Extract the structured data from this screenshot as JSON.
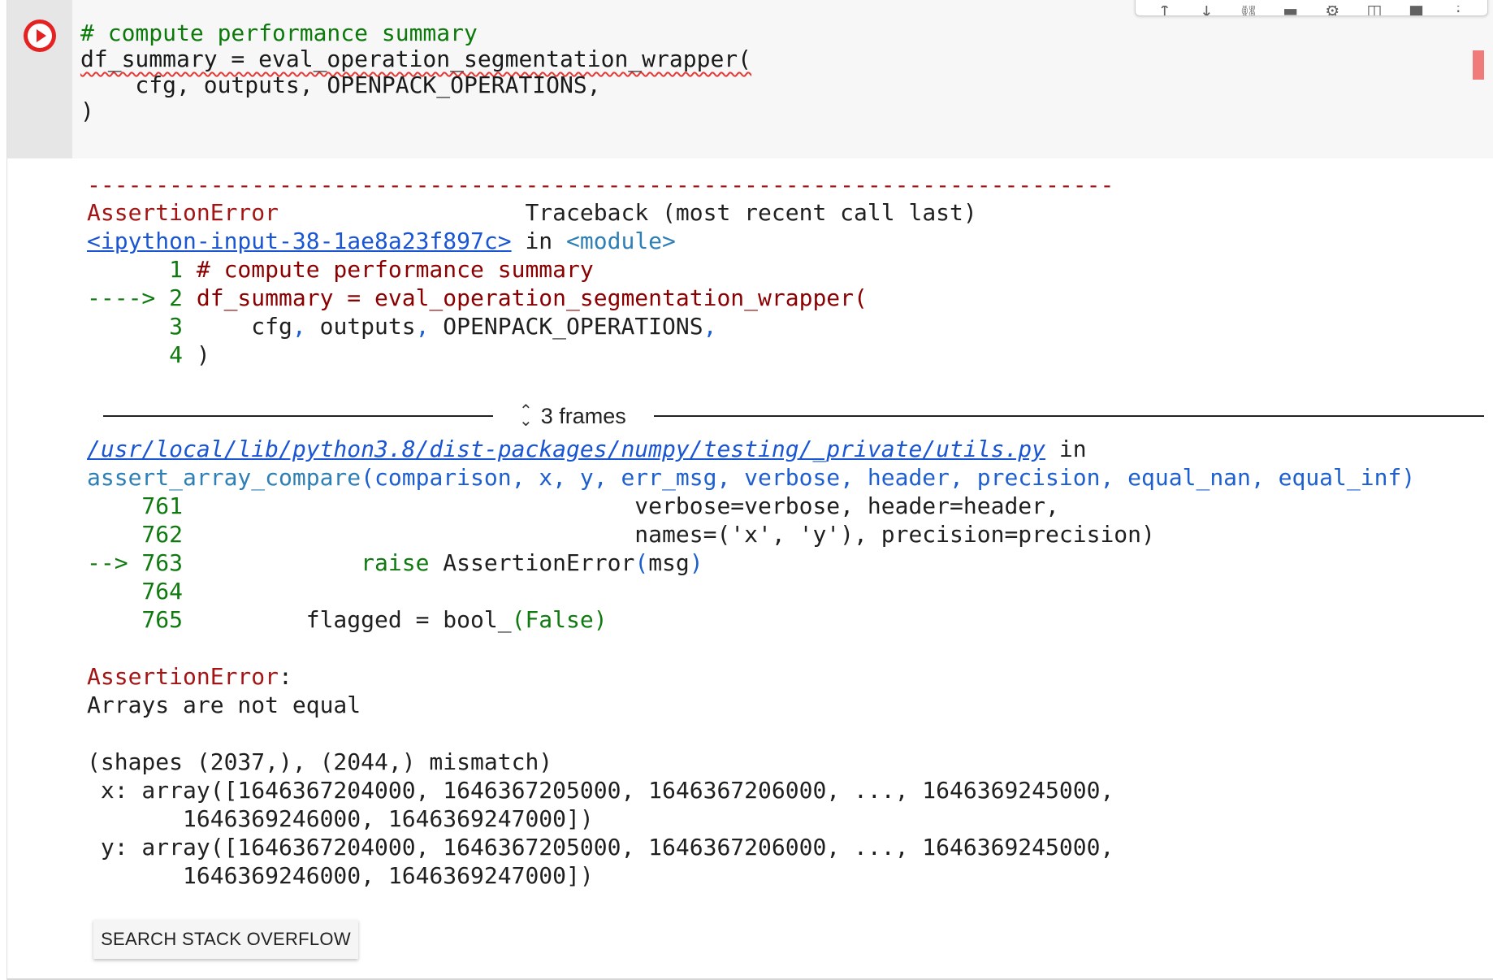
{
  "toolbar": {
    "icons": [
      "arrow-up-icon",
      "arrow-down-icon",
      "link-icon",
      "comment-icon",
      "settings-icon",
      "mirror-cell-icon",
      "delete-icon",
      "more-icon"
    ]
  },
  "input": {
    "line1": "# compute performance summary",
    "line2_var": "df_summary = eval_operation_segmentation_wrapper(",
    "line3": "    cfg, outputs, OPENPACK_OPERATIONS,",
    "line4": ")"
  },
  "output": {
    "dashes": "---------------------------------------------------------------------------",
    "err_name": "AssertionError",
    "traceback_label": "Traceback (most recent call last)",
    "frame1_link": "<ipython-input-38-1ae8a23f897c>",
    "frame1_in": " in ",
    "frame1_module": "<module>",
    "f1_l1_num": "      1 ",
    "f1_l1_code": "# compute performance summary",
    "f1_l2_arrow": "----> 2 ",
    "f1_l2_code": "df_summary = eval_operation_segmentation_wrapper(",
    "f1_l3_num": "      3 ",
    "f1_l3_code": "    cfg",
    "f1_l3_comma1": ",",
    "f1_l3_mid": " outputs",
    "f1_l3_comma2": ",",
    "f1_l3_end": " OPENPACK_OPERATIONS",
    "f1_l3_comma3": ",",
    "f1_l4_num": "      4 ",
    "f1_l4_code": ")",
    "frames_label": "3 frames",
    "frame2_link": "/usr/local/lib/python3.8/dist-packages/numpy/testing/_private/utils.py",
    "frame2_in": " in",
    "frame2_func": "assert_array_compare",
    "frame2_sig": "(comparison, x, y, err_msg, verbose, header, precision, equal_nan, equal_inf)",
    "l761_num": "    761 ",
    "l761_code": "                                verbose=verbose, header=header,",
    "l762_num": "    762 ",
    "l762_code": "                                names=('x', 'y'), precision=precision)",
    "l763_arrow": "--> 763 ",
    "l763_pad": "            ",
    "l763_kw": "raise",
    "l763_code": " AssertionError",
    "l763_paren1": "(",
    "l763_arg": "msg",
    "l763_paren2": ")",
    "l764_num": "    764 ",
    "l765_num": "    765 ",
    "l765_code": "        flagged = bool_",
    "l765_rest": "(False)",
    "final_err": "AssertionError",
    "final_colon": ":",
    "msg1": "Arrays are not equal",
    "msg2": "(shapes (2037,), (2044,) mismatch)",
    "msg3": " x: array([1646367204000, 1646367205000, 1646367206000, ..., 1646369245000,",
    "msg4": "       1646369246000, 1646369247000])",
    "msg5": " y: array([1646367204000, 1646367205000, 1646367206000, ..., 1646369245000,",
    "msg6": "       1646369246000, 1646369247000])"
  },
  "buttons": {
    "search_so": "SEARCH STACK OVERFLOW"
  },
  "colors": {
    "run_button": "#e52222",
    "error_red": "#a31515",
    "line_number_green": "#0f7a0f",
    "link_blue": "#1a55d4"
  }
}
